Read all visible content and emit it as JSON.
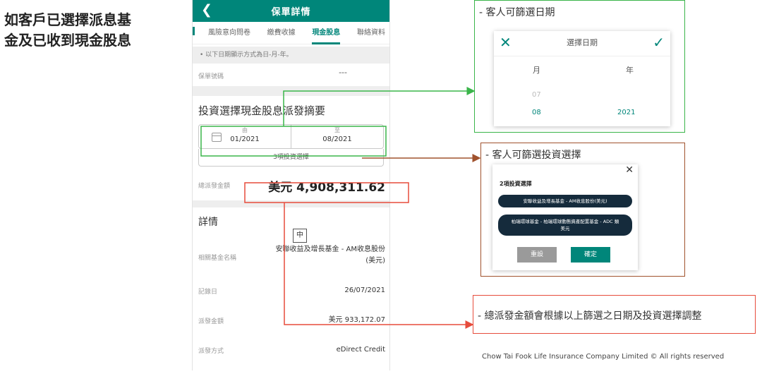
{
  "heading": {
    "line1": "如客戶已選擇派息基",
    "line2": "金及已收到現金股息"
  },
  "app": {
    "title": "保單詳情",
    "tabs": [
      "風險意向問卷",
      "繳費收據",
      "現金股息",
      "聯絡資料"
    ],
    "active_tab": "現金股息",
    "notice": "• 以下日期顯示方式為日-月-年。",
    "policy_label": "保單號碼",
    "policy_value": "---",
    "section_title": "投資選擇現金股息派發摘要",
    "date_from_label": "由",
    "date_from": "01/2021",
    "date_to_label": "至",
    "date_to": "08/2021",
    "investment_count": "3項投資選擇",
    "total_label": "總派發金額",
    "total_value": "美元 4,908,311.62",
    "details_title": "詳情",
    "lang_button": "中",
    "details": [
      {
        "label": "相關基金名稱",
        "value": "安聯收益及增長基金 - AM收息股份(美元)"
      },
      {
        "label": "記錄日",
        "value": "26/07/2021"
      },
      {
        "label": "派發金額",
        "value": "美元 933,172.07"
      },
      {
        "label": "派發方式",
        "value": "eDirect Credit"
      }
    ]
  },
  "callout_date": {
    "text": "- 客人可篩選日期",
    "picker_title": "選擇日期",
    "month_label": "月",
    "year_label": "年",
    "month_faint": "07",
    "month_selected": "08",
    "year_selected": "2021"
  },
  "callout_invest": {
    "text": "- 客人可篩選投資選擇",
    "modal_title": "2項投資選擇",
    "chip1": "安聯收益及增長基金 - AM收息股份(美元)",
    "chip2": "柏瑞環球基金 - 柏瑞環球動態資產配置基金 - ADC 類美元",
    "reset": "重設",
    "confirm": "確定"
  },
  "callout_total": {
    "text": "- 總派發金額會根據以上篩選之日期及投資選擇調整"
  },
  "colors": {
    "brand": "#00867a",
    "green_callout": "#3ab54a",
    "brown_callout": "#a0522d",
    "red_callout": "#e74c3c"
  },
  "copyright": "Chow Tai Fook Life Insurance Company Limited © All rights reserved"
}
